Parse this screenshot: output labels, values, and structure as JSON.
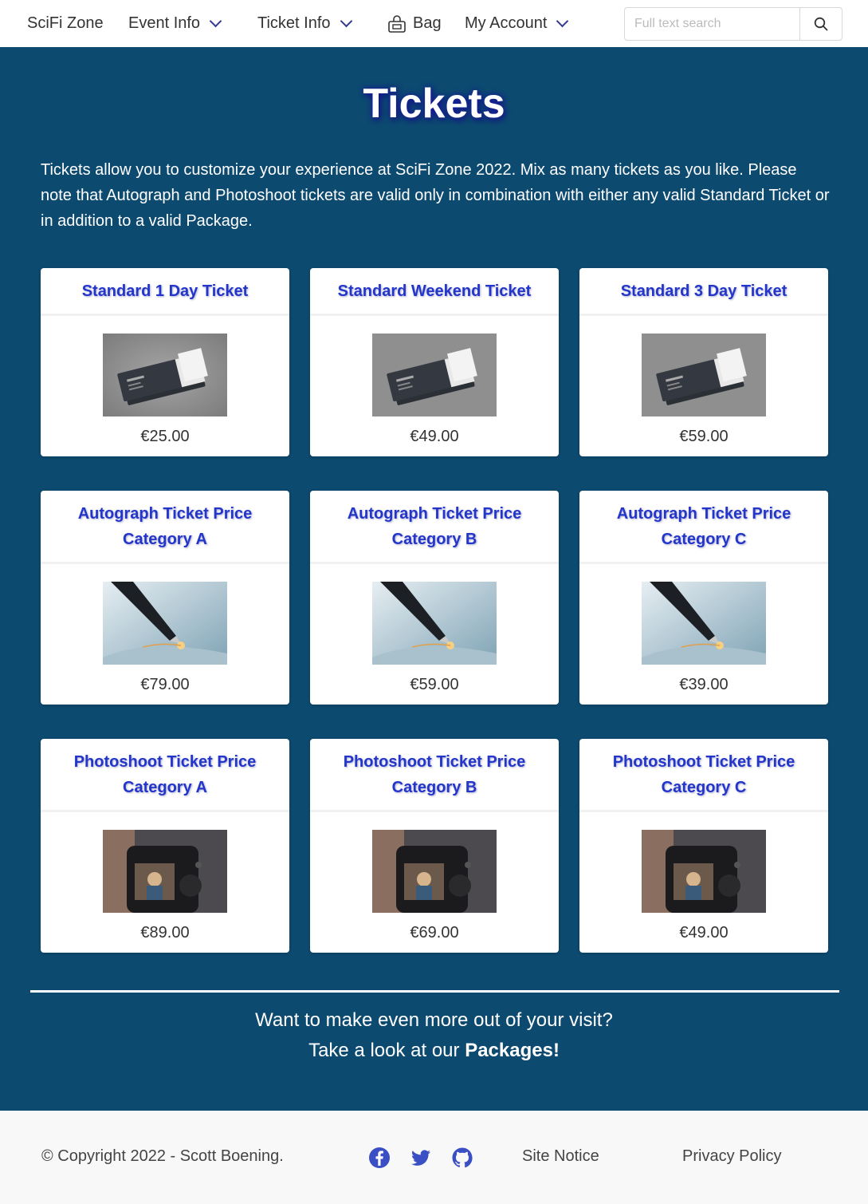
{
  "nav": {
    "brand": "SciFi Zone",
    "event_info": "Event Info",
    "ticket_info": "Ticket Info",
    "bag": "Bag",
    "my_account": "My Account",
    "search_placeholder": "Full text search"
  },
  "main": {
    "title": "Tickets",
    "intro": "Tickets allow you to customize your experience at SciFi Zone 2022. Mix as many tickets as you like. Please note that Autograph and Photoshoot tickets are valid only in combination with either any valid Standard Ticket or in addition to a valid Package.",
    "tickets": [
      {
        "title": "Standard 1 Day Ticket",
        "price": "€25.00",
        "image": "ticket-image"
      },
      {
        "title": "Standard Weekend Ticket",
        "price": "€49.00",
        "image": "ticket-image"
      },
      {
        "title": "Standard 3 Day Ticket",
        "price": "€59.00",
        "image": "ticket-image"
      },
      {
        "title": "Autograph Ticket Price Category A",
        "price": "€79.00",
        "image": "pen-image"
      },
      {
        "title": "Autograph Ticket Price Category B",
        "price": "€59.00",
        "image": "pen-image"
      },
      {
        "title": "Autograph Ticket Price Category C",
        "price": "€39.00",
        "image": "pen-image"
      },
      {
        "title": "Photoshoot Ticket Price Category A",
        "price": "€89.00",
        "image": "camera-image"
      },
      {
        "title": "Photoshoot Ticket Price Category B",
        "price": "€69.00",
        "image": "camera-image"
      },
      {
        "title": "Photoshoot Ticket Price Category C",
        "price": "€49.00",
        "image": "camera-image"
      }
    ],
    "cta_line1": "Want to make even more out of your visit?",
    "cta_line2_prefix": "Take a look at our ",
    "cta_link": "Packages!"
  },
  "footer": {
    "copyright": "© Copyright 2022 - Scott Boening.",
    "site_notice": "Site Notice",
    "privacy_policy": "Privacy Policy",
    "icons": [
      "facebook-icon",
      "twitter-icon",
      "github-icon"
    ]
  },
  "colors": {
    "background": "#0d4a70",
    "card_title": "#2336c9",
    "accent_icon": "#333a8f"
  }
}
